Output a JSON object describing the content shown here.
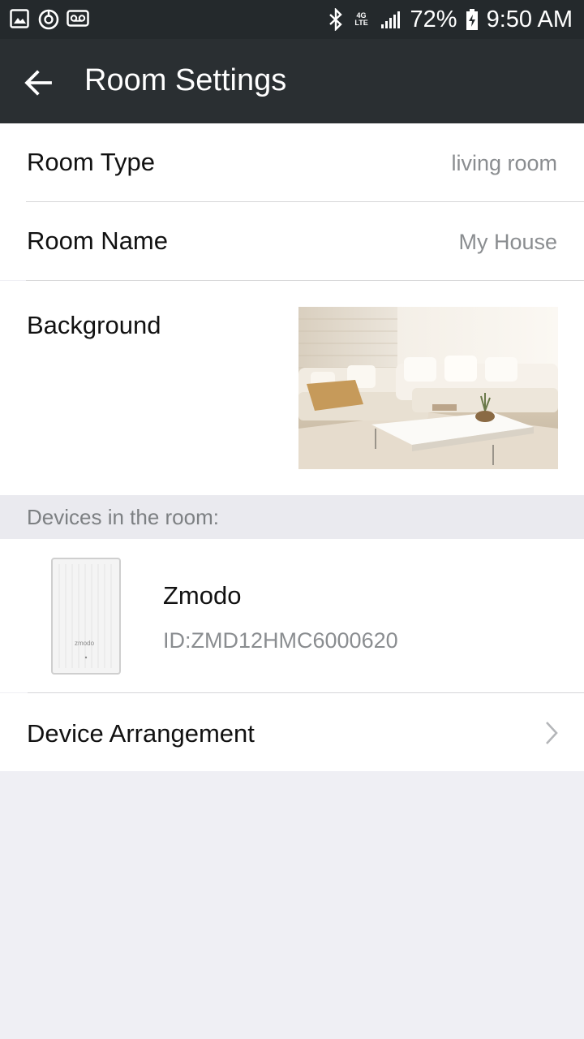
{
  "status_bar": {
    "battery": "72%",
    "time": "9:50 AM",
    "network": "4G LTE"
  },
  "header": {
    "title": "Room Settings"
  },
  "settings": {
    "room_type_label": "Room Type",
    "room_type_value": "living room",
    "room_name_label": "Room Name",
    "room_name_value": "My House",
    "background_label": "Background"
  },
  "devices_section": {
    "header": "Devices in the room:",
    "devices": [
      {
        "name": "Zmodo",
        "id": "ID:ZMD12HMC6000620",
        "brand_mark": "zmodo"
      }
    ]
  },
  "device_arrangement_label": "Device Arrangement",
  "colors": {
    "app_bar": "#2a2f32",
    "status_bar": "#24292c",
    "page_background": "#efeff4",
    "secondary_text": "#8a8d90"
  }
}
